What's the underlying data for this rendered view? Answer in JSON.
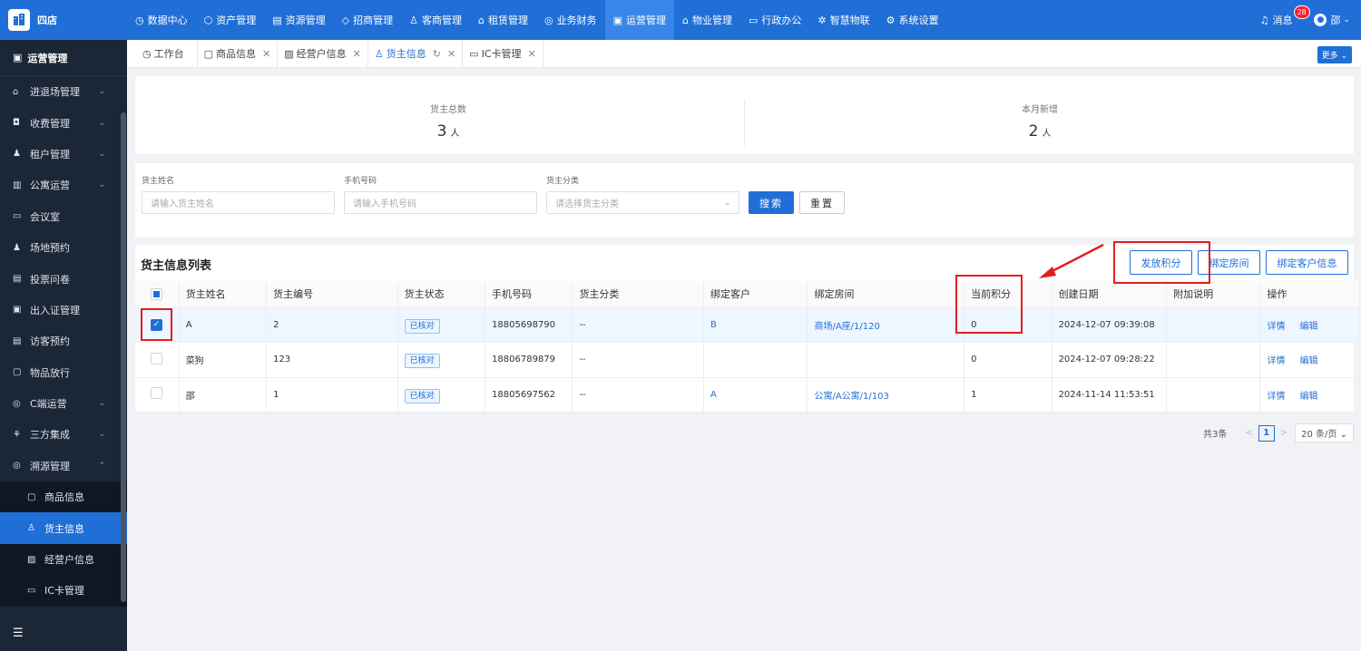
{
  "app": {
    "name": "四店"
  },
  "topnav": [
    {
      "icon": "◷",
      "label": "数据中心"
    },
    {
      "icon": "⬡",
      "label": "资产管理"
    },
    {
      "icon": "▤",
      "label": "资源管理"
    },
    {
      "icon": "◇",
      "label": "招商管理"
    },
    {
      "icon": "♙",
      "label": "客商管理"
    },
    {
      "icon": "⌂",
      "label": "租赁管理"
    },
    {
      "icon": "◎",
      "label": "业务财务"
    },
    {
      "icon": "▣",
      "label": "运营管理"
    },
    {
      "icon": "⌂",
      "label": "物业管理"
    },
    {
      "icon": "▭",
      "label": "行政办公"
    },
    {
      "icon": "✲",
      "label": "智慧物联"
    },
    {
      "icon": "⚙",
      "label": "系统设置"
    }
  ],
  "header": {
    "messages_label": "消息",
    "messages_count": "28",
    "user_name": "邵"
  },
  "sidebar": {
    "title": "运营管理",
    "items": [
      {
        "icon": "⌂",
        "label": "进退场管理",
        "arrow": "⌄"
      },
      {
        "icon": "◘",
        "label": "收费管理",
        "arrow": "⌄"
      },
      {
        "icon": "♟",
        "label": "租户管理",
        "arrow": "⌄"
      },
      {
        "icon": "▥",
        "label": "公寓运营",
        "arrow": "⌄"
      },
      {
        "icon": "▭",
        "label": "会议室",
        "arrow": ""
      },
      {
        "icon": "♟",
        "label": "场地预约",
        "arrow": ""
      },
      {
        "icon": "▤",
        "label": "投票问卷",
        "arrow": ""
      },
      {
        "icon": "▣",
        "label": "出入证管理",
        "arrow": ""
      },
      {
        "icon": "▤",
        "label": "访客预约",
        "arrow": ""
      },
      {
        "icon": "▢",
        "label": "物品放行",
        "arrow": ""
      },
      {
        "icon": "◎",
        "label": "C端运营",
        "arrow": "⌄"
      },
      {
        "icon": "⚘",
        "label": "三方集成",
        "arrow": "⌄"
      },
      {
        "icon": "◎",
        "label": "溯源管理",
        "arrow": "⌃"
      }
    ],
    "sub_items": [
      {
        "icon": "▢",
        "label": "商品信息"
      },
      {
        "icon": "♙",
        "label": "货主信息"
      },
      {
        "icon": "▨",
        "label": "经营户信息"
      },
      {
        "icon": "▭",
        "label": "IC卡管理"
      }
    ]
  },
  "tabs": [
    {
      "icon": "◷",
      "label": "工作台",
      "close": ""
    },
    {
      "icon": "▢",
      "label": "商品信息",
      "close": "✕"
    },
    {
      "icon": "▨",
      "label": "经营户信息",
      "close": "✕"
    },
    {
      "icon": "♙",
      "label": "货主信息",
      "close": "✕"
    },
    {
      "icon": "▭",
      "label": "IC卡管理",
      "close": "✕"
    }
  ],
  "tabs_more": "更多 ⌄",
  "stats": {
    "total_label": "货主总数",
    "total_value": "3",
    "total_unit": "人",
    "new_label": "本月新增",
    "new_value": "2",
    "new_unit": "人"
  },
  "filters": {
    "name_label": "货主姓名",
    "name_placeholder": "请输入货主姓名",
    "phone_label": "手机号码",
    "phone_placeholder": "请输入手机号码",
    "category_label": "货主分类",
    "category_placeholder": "请选择货主分类",
    "search": "搜索",
    "reset": "重置"
  },
  "list": {
    "title": "货主信息列表",
    "btn_points": "发放积分",
    "btn_room": "绑定房间",
    "btn_customer": "绑定客户信息",
    "columns": [
      "货主姓名",
      "货主编号",
      "货主状态",
      "手机号码",
      "货主分类",
      "绑定客户",
      "绑定房间",
      "当前积分",
      "创建日期",
      "附加说明",
      "操作"
    ],
    "rows": [
      {
        "name": "A",
        "code": "2",
        "status": "已核对",
        "phone": "18805698790",
        "category": "--",
        "customer": "B",
        "room": "商场/A座/1/120",
        "points": "0",
        "date": "2024-12-07 09:39:08",
        "note": "",
        "detail": "详情",
        "edit": "编辑"
      },
      {
        "name": "菜狗",
        "code": "123",
        "status": "已核对",
        "phone": "18806789879",
        "category": "--",
        "customer": "",
        "room": "",
        "points": "0",
        "date": "2024-12-07 09:28:22",
        "note": "",
        "detail": "详情",
        "edit": "编辑"
      },
      {
        "name": "邵",
        "code": "1",
        "status": "已核对",
        "phone": "18805697562",
        "category": "--",
        "customer": "A",
        "room": "公寓/A公寓/1/103",
        "points": "1",
        "date": "2024-11-14 11:53:51",
        "note": "",
        "detail": "详情",
        "edit": "编辑"
      }
    ]
  },
  "pagination": {
    "total": "共3条",
    "prev": "<",
    "current": "1",
    "next": ">",
    "page_size": "20 条/页 ⌄"
  },
  "colors": {
    "primary": "#1f6fd6",
    "sidebar": "#1b2636",
    "highlight": "#e02020"
  }
}
